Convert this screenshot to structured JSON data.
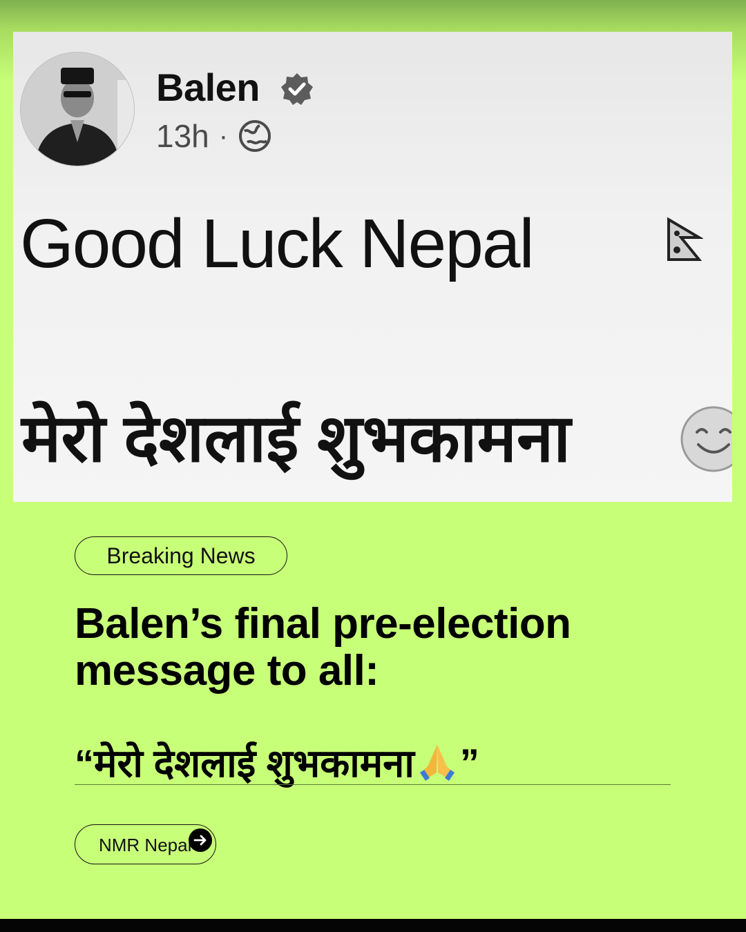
{
  "post": {
    "author": "Balen",
    "time": "13h",
    "separator": "·",
    "line1": "Good Luck Nepal",
    "line2": "मेरो देशलाई शुभकामना",
    "icons": {
      "verified": "verified-badge-icon",
      "audience": "globe-icon",
      "flag": "nepal-flag-icon",
      "emoji": "smiling-face-icon"
    }
  },
  "card": {
    "badge": "Breaking News",
    "headline": "Balen’s final pre-election message to all:",
    "quote_open": "“मेरो देशलाई शुभकामना",
    "quote_close": "”",
    "quote_emoji": "folded-hands-icon",
    "source": "NMR Nepal",
    "source_icon": "arrow-right-icon"
  },
  "colors": {
    "background": "#c8ff78",
    "text": "#000000",
    "post_background": "#f2f2f2"
  }
}
